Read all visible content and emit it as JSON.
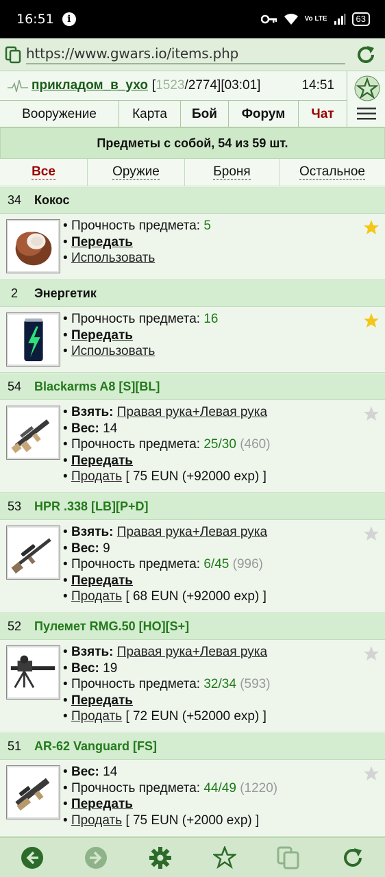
{
  "status_bar": {
    "time": "16:51",
    "battery": "63",
    "network": "Vo LTE"
  },
  "browser": {
    "url": "https://www.gwars.io/items.php"
  },
  "header": {
    "nickname": "прикладом_в_ухо",
    "stats_open": "[",
    "hp_current": "1523",
    "hp_rest": "/2774][03:01]",
    "clock": "14:51",
    "nav": [
      "Вооружение",
      "Карта",
      "Бой",
      "Форум",
      "Чат"
    ]
  },
  "summary": "Предметы с собой, 54 из 59 шт.",
  "filters": [
    "Все",
    "Оружие",
    "Броня",
    "Остальное"
  ],
  "labels": {
    "durability": "Прочность предмета:",
    "take": "Взять:",
    "weight": "Вес:",
    "transfer": "Передать",
    "use": "Использовать",
    "sell": "Продать"
  },
  "items": [
    {
      "qty": "34",
      "name": "Кокос",
      "durability": "5",
      "favorite": true,
      "icon": "coconut-image"
    },
    {
      "qty": "2",
      "name": "Энергетик",
      "durability": "16",
      "favorite": true,
      "icon": "energy-drink-image"
    },
    {
      "qty": "54",
      "name": "Blackarms A8 [S][BL]",
      "take": "Правая рука+Левая рука",
      "weight": "14",
      "durability": "25/30",
      "durability_extra": "(460)",
      "sell_price": "[ 75 EUN (+92000 exp) ]",
      "favorite": false,
      "icon": "assault-rifle-image"
    },
    {
      "qty": "53",
      "name": "HPR .338 [LB][P+D]",
      "take": "Правая рука+Левая рука",
      "weight": "9",
      "durability": "6/45",
      "durability_extra": "(996)",
      "sell_price": "[ 68 EUN (+92000 exp) ]",
      "favorite": false,
      "icon": "sniper-rifle-image"
    },
    {
      "qty": "52",
      "name": "Пулемет RMG.50 [HO][S+]",
      "take": "Правая рука+Левая рука",
      "weight": "19",
      "durability": "32/34",
      "durability_extra": "(593)",
      "sell_price": "[ 72 EUN (+52000 exp) ]",
      "favorite": false,
      "icon": "machine-gun-image"
    },
    {
      "qty": "51",
      "name": "AR-62 Vanguard [FS]",
      "weight": "14",
      "durability": "44/49",
      "durability_extra": "(1220)",
      "sell_price": "[ 75 EUN (+2000 exp) ]",
      "favorite": false,
      "icon": "bullpup-rifle-image"
    }
  ],
  "colors": {
    "accent_green": "#1f7a18",
    "nav_red": "#990000",
    "star_gold": "#f5c518",
    "header_bg": "#d4ecd0"
  }
}
